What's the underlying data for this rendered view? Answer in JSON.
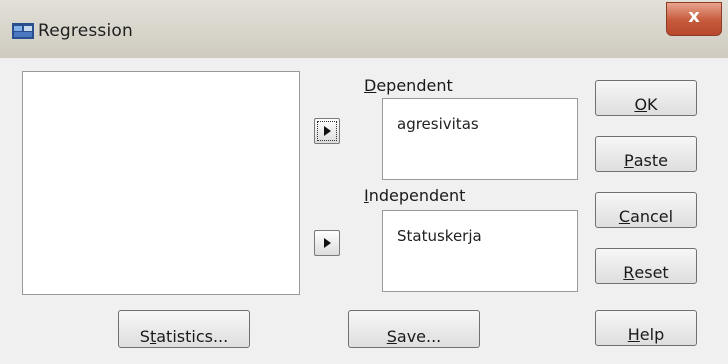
{
  "window": {
    "title": "Regression",
    "close_label": "x"
  },
  "source_list": {
    "items": []
  },
  "dependent": {
    "label_first": "D",
    "label_rest": "ependent",
    "value": "agresivitas"
  },
  "independent": {
    "label_first": "I",
    "label_rest": "ndependent",
    "value": "Statuskerja"
  },
  "buttons": {
    "ok": {
      "mn": "O",
      "rest": "K"
    },
    "paste": {
      "mn": "P",
      "rest": "aste"
    },
    "cancel": {
      "mn": "C",
      "rest": "ancel"
    },
    "reset": {
      "mn": "R",
      "rest": "eset"
    },
    "help": {
      "mn": "H",
      "rest": "elp"
    },
    "statistics": {
      "pre": "S",
      "mn": "t",
      "rest": "atistics..."
    },
    "save": {
      "mn": "S",
      "rest": "ave..."
    }
  },
  "icons": {
    "app": "spss-app-icon",
    "close": "close-icon",
    "move_right": "arrow-right-icon"
  },
  "colors": {
    "titlebar": "#d8d5cc",
    "close": "#c65a3c",
    "dialog_bg": "#f0f0f0"
  }
}
